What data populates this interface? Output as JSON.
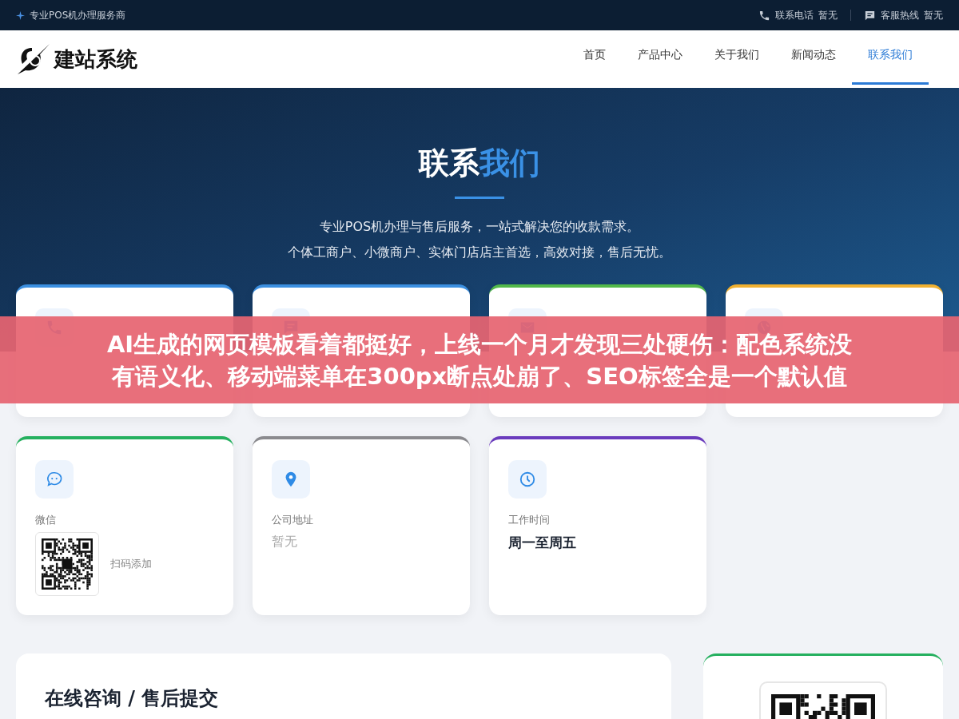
{
  "top_bar": {
    "tagline": "专业POS机办理服务商",
    "contacts": [
      {
        "kind": "phone",
        "label": "联系电话",
        "value": "暂无"
      },
      {
        "kind": "chat",
        "label": "客服热线",
        "value": "暂无"
      }
    ]
  },
  "header": {
    "logo_text": "建站系统",
    "nav": [
      {
        "label": "首页",
        "selected": false
      },
      {
        "label": "产品中心",
        "selected": false
      },
      {
        "label": "关于我们",
        "selected": false
      },
      {
        "label": "新闻动态",
        "selected": false
      },
      {
        "label": "联系我们",
        "selected": true
      }
    ]
  },
  "hero": {
    "title": "联系",
    "title_highlight": "我们",
    "lines": [
      "专业POS机办理与售后服务，一站式解决您的收款需求。",
      "个体工商户、小微商户、实体门店店主首选，高效对接，售后无忧。"
    ]
  },
  "cards": [
    {
      "kind": "phone",
      "color": "#3b8fe0"
    },
    {
      "kind": "chat",
      "color": "#3b8fe0"
    },
    {
      "kind": "mail",
      "color": "#52b84a"
    },
    {
      "kind": "globe",
      "color": "#f0b030"
    },
    {
      "kind": "wechat",
      "color": "#25b05f",
      "label": "微信",
      "caption": "扫码添加"
    },
    {
      "kind": "location",
      "color": "#8a8a8e",
      "label": "公司地址",
      "value": "暂无",
      "muted": true
    },
    {
      "kind": "clock",
      "color": "#6a3bbd",
      "label": "工作时间",
      "value": "周一至周五",
      "muted": false
    }
  ],
  "form": {
    "title": "在线咨询 / 售后提交"
  },
  "side_card": {
    "color": "#25b05f"
  },
  "overlay_caption": {
    "lines": [
      "AI生成的网页模板看着都挺好，上线一个月才发现三处硬伤：配色系统没",
      "有语义化、移动端菜单在300px断点处崩了、SEO标签全是一个默认值"
    ]
  }
}
